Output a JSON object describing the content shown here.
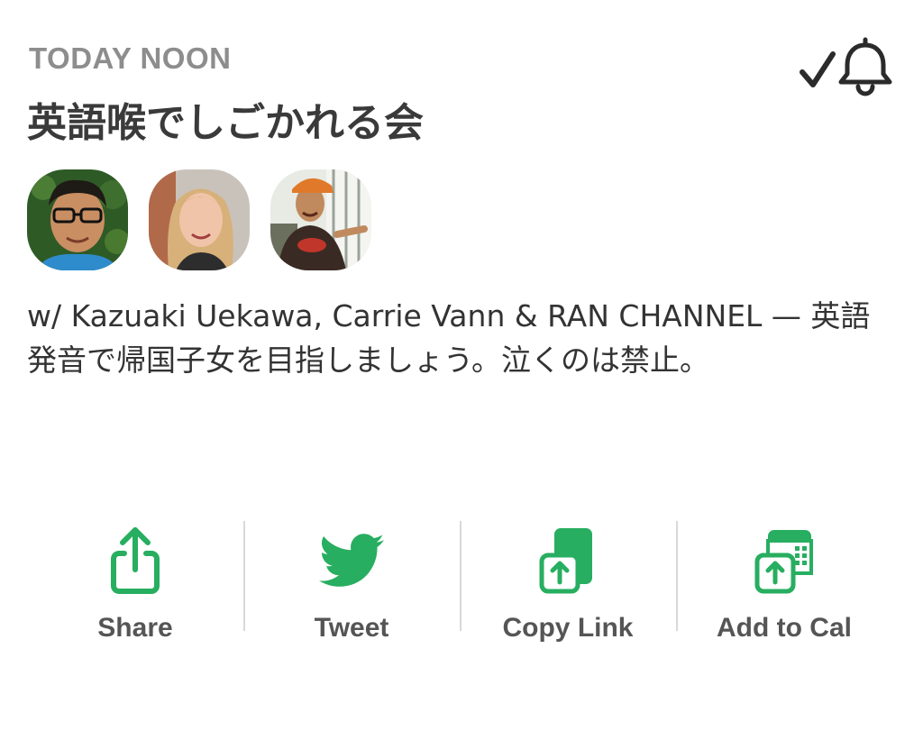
{
  "event": {
    "when": "TODAY NOON",
    "title": "英語喉でしごかれる会",
    "description": "w/ Kazuaki Uekawa, Carrie Vann & RAN CHANNEL — 英語発音で帰国子女を目指しましょう。泣くのは禁止。",
    "notify_icon": "check-bell-icon"
  },
  "hosts": [
    {
      "name": "Kazuaki Uekawa",
      "icon": "avatar"
    },
    {
      "name": "Carrie Vann",
      "icon": "avatar"
    },
    {
      "name": "RAN CHANNEL",
      "icon": "avatar"
    }
  ],
  "actions": [
    {
      "label": "Share",
      "icon": "share-icon"
    },
    {
      "label": "Tweet",
      "icon": "twitter-bird-icon"
    },
    {
      "label": "Copy Link",
      "icon": "copy-link-icon"
    },
    {
      "label": "Add to Cal",
      "icon": "add-to-calendar-icon"
    }
  ],
  "colors": {
    "accent": "#27ae60",
    "muted_text": "#8d8d8d",
    "divider": "#d8d8d8"
  }
}
